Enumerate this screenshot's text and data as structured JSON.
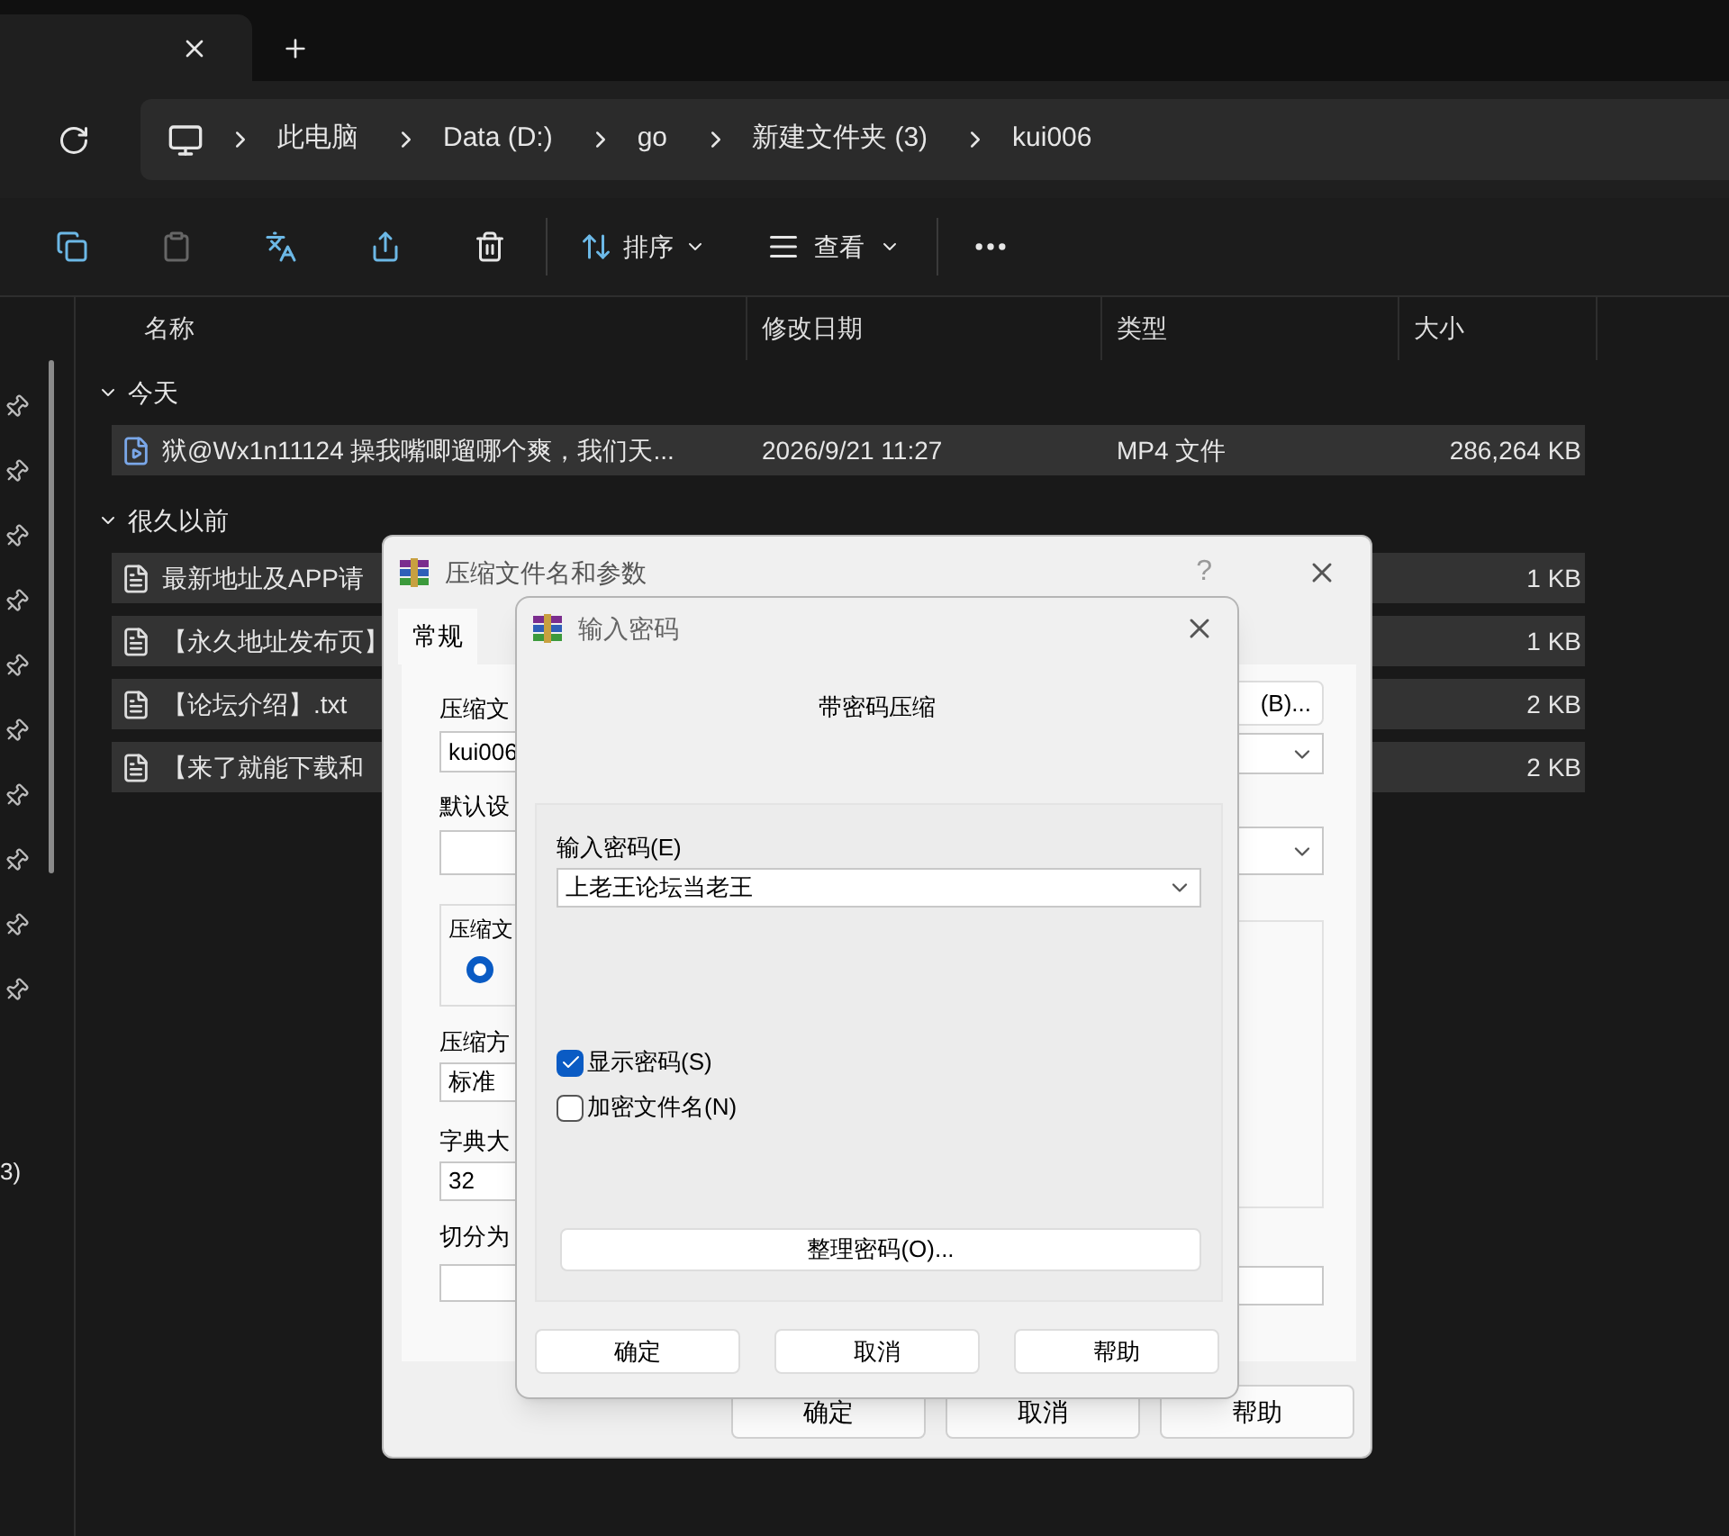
{
  "breadcrumbs": [
    "此电脑",
    "Data (D:)",
    "go",
    "新建文件夹 (3)",
    "kui006"
  ],
  "toolbar": {
    "sort": "排序",
    "view": "查看"
  },
  "nav_pane": {
    "partial_label": "3)"
  },
  "columns": [
    "名称",
    "修改日期",
    "类型",
    "大小"
  ],
  "groups": [
    {
      "label": "今天",
      "expanded": true,
      "files": [
        {
          "kind": "video",
          "name": "狱@Wx1n11124 操我嘴唧遛哪个爽，我们天...",
          "modified": "2026/9/21 11:27",
          "type": "MP4 文件",
          "size": "286,264 KB",
          "selected": true
        }
      ]
    },
    {
      "label": "很久以前",
      "expanded": true,
      "files": [
        {
          "kind": "text",
          "name": "最新地址及APP请",
          "size": "1 KB",
          "selected": true
        },
        {
          "kind": "text",
          "name": "【永久地址发布页】",
          "size": "1 KB",
          "selected": true
        },
        {
          "kind": "text",
          "name": "【论坛介绍】.txt",
          "size": "2 KB",
          "selected": true
        },
        {
          "kind": "text",
          "name": "【来了就能下载和",
          "size": "2 KB",
          "selected": true
        }
      ]
    }
  ],
  "archive_dialog": {
    "title": "压缩文件名和参数",
    "help": "?",
    "tabs": [
      {
        "label": "常规",
        "selected": true
      }
    ],
    "archive_name_label": "压缩文",
    "archive_name": "kui006",
    "profile_label": "默认设",
    "format_group_label": "压缩文",
    "format_radio_selected": true,
    "method_label": "压缩方",
    "method": "标准",
    "dictionary_label": "字典大",
    "dictionary": "32",
    "split_label": "切分为",
    "browse_button": "(B)...",
    "buttons": [
      "确定",
      "取消",
      "帮助"
    ]
  },
  "password_dialog": {
    "title": "输入密码",
    "heading": "带密码压缩",
    "password_label": "输入密码(E)",
    "password": "上老王论坛当老王",
    "options": [
      {
        "label": "显示密码(S)",
        "checked": true
      },
      {
        "label": "加密文件名(N)",
        "checked": false
      }
    ],
    "organize_button": "整理密码(O)...",
    "buttons": [
      "确定",
      "取消",
      "帮助"
    ]
  }
}
